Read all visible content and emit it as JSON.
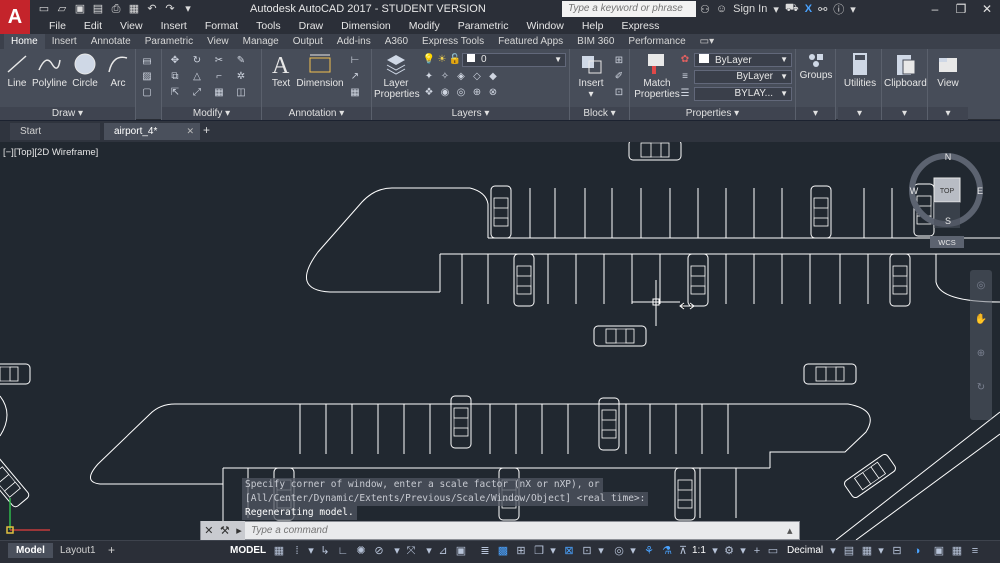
{
  "app": {
    "logo": "A",
    "title": "Autodesk AutoCAD 2017 - STUDENT VERSION",
    "search_placeholder": "Type a keyword or phrase",
    "sign_in": "Sign In"
  },
  "menus": [
    "File",
    "Edit",
    "View",
    "Insert",
    "Format",
    "Tools",
    "Draw",
    "Dimension",
    "Modify",
    "Parametric",
    "Window",
    "Help",
    "Express"
  ],
  "ribbon_tabs": [
    "Home",
    "Insert",
    "Annotate",
    "Parametric",
    "View",
    "Manage",
    "Output",
    "Add-ins",
    "A360",
    "Express Tools",
    "Featured Apps",
    "BIM 360",
    "Performance"
  ],
  "ribbon": {
    "draw": {
      "label": "Draw",
      "tools": [
        "Line",
        "Polyline",
        "Circle",
        "Arc"
      ]
    },
    "modify": {
      "label": "Modify"
    },
    "annotation": {
      "label": "Annotation",
      "tools": [
        "Text",
        "Dimension"
      ]
    },
    "layers": {
      "label": "Layers",
      "tool": "Layer Properties",
      "tool_line2": "Properties",
      "tool_line1": "Layer",
      "current_layer": "0"
    },
    "block": {
      "label": "Block",
      "tool": "Insert"
    },
    "properties": {
      "label": "Properties",
      "tool_line1": "Match",
      "tool_line2": "Properties",
      "color": "ByLayer",
      "linetype": "ByLayer",
      "lineweight": "BYLAY..."
    },
    "groups": {
      "label": "Groups"
    },
    "utilities": {
      "label": "Utilities"
    },
    "clipboard": {
      "label": "Clipboard"
    },
    "view": {
      "label": "View"
    }
  },
  "doc_tabs": {
    "start": "Start",
    "drawing": "airport_4*"
  },
  "viewport_label": "[−][Top][2D Wireframe]",
  "viewcube": {
    "north": "N",
    "south": "S",
    "east": "E",
    "west": "W",
    "face": "TOP",
    "wcs": "WCS"
  },
  "command_history": [
    "Specify corner of window, enter a scale factor (nX or nXP), or",
    "[All/Center/Dynamic/Extents/Previous/Scale/Window/Object] <real time>:",
    "Regenerating model."
  ],
  "command_placeholder": "Type a command",
  "layout_tabs": [
    "Model",
    "Layout1"
  ],
  "status": {
    "space": "MODEL",
    "scale": "1:1",
    "units": "Decimal"
  },
  "colors": {
    "accent": "#c4242b",
    "canvas": "#212830",
    "ribbon": "#474d59",
    "linework": "#ffffff"
  }
}
